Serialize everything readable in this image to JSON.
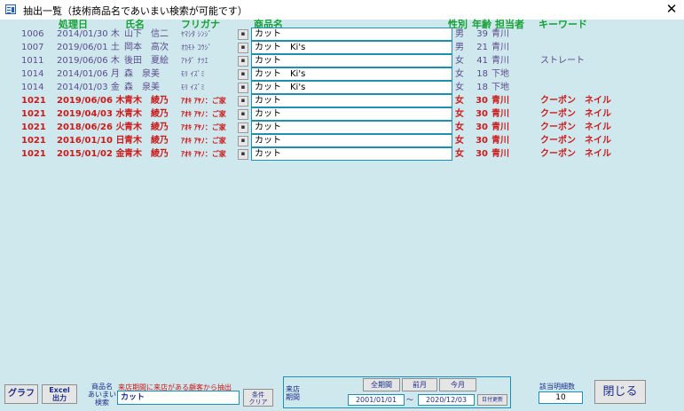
{
  "window": {
    "title": "抽出一覧（技術商品名であいまい検索が可能です）",
    "close_glyph": "✕",
    "icon": "form-icon"
  },
  "headers": {
    "date": "処理日",
    "name": "氏名",
    "kana": "フリガナ",
    "product": "商品名",
    "gender": "性別",
    "age": "年齢",
    "staff": "担当者",
    "keyword": "キーワード"
  },
  "row_button_glyph": "▪",
  "rows": [
    {
      "id": "1006",
      "date": "2014/01/30 木",
      "name": "山下　信二",
      "kana": "ﾔﾏｼﾀ ｼﾝｼﾞ",
      "product": "カット",
      "gender": "男",
      "age": "39",
      "staff": "青川",
      "keyword": "",
      "highlight": false
    },
    {
      "id": "1007",
      "date": "2019/06/01 土",
      "name": "岡本　高次",
      "kana": "ｵｶﾓﾄ ｺｳｼﾞ",
      "product": "カット　Ki's",
      "gender": "男",
      "age": "21",
      "staff": "青川",
      "keyword": "",
      "highlight": false
    },
    {
      "id": "1011",
      "date": "2019/06/06 木",
      "name": "後田　夏絵",
      "kana": "ｱﾄﾀﾞ ﾅﾂｴ",
      "product": "カット",
      "gender": "女",
      "age": "41",
      "staff": "青川",
      "keyword": "ストレート",
      "highlight": false
    },
    {
      "id": "1014",
      "date": "2014/01/06 月",
      "name": "森　泉美",
      "kana": "ﾓﾘ ｲｽﾞﾐ",
      "product": "カット　Ki's",
      "gender": "女",
      "age": "18",
      "staff": "下地",
      "keyword": "",
      "highlight": false
    },
    {
      "id": "1014",
      "date": "2014/01/03 金",
      "name": "森　泉美",
      "kana": "ﾓﾘ ｲｽﾞﾐ",
      "product": "カット　Ki's",
      "gender": "女",
      "age": "18",
      "staff": "下地",
      "keyword": "",
      "highlight": false
    },
    {
      "id": "1021",
      "date": "2019/06/06 木",
      "name": "青木　綾乃",
      "kana": "ｱｵｷ ｱﾔﾉ：ご家",
      "product": "カット",
      "gender": "女",
      "age": "30",
      "staff": "青川",
      "keyword": "クーポン　ネイル",
      "highlight": true
    },
    {
      "id": "1021",
      "date": "2019/04/03 水",
      "name": "青木　綾乃",
      "kana": "ｱｵｷ ｱﾔﾉ：ご家",
      "product": "カット",
      "gender": "女",
      "age": "30",
      "staff": "青川",
      "keyword": "クーポン　ネイル",
      "highlight": true
    },
    {
      "id": "1021",
      "date": "2018/06/26 火",
      "name": "青木　綾乃",
      "kana": "ｱｵｷ ｱﾔﾉ：ご家",
      "product": "カット",
      "gender": "女",
      "age": "30",
      "staff": "青川",
      "keyword": "クーポン　ネイル",
      "highlight": true
    },
    {
      "id": "1021",
      "date": "2016/01/10 日",
      "name": "青木　綾乃",
      "kana": "ｱｵｷ ｱﾔﾉ：ご家",
      "product": "カット",
      "gender": "女",
      "age": "30",
      "staff": "青川",
      "keyword": "クーポン　ネイル",
      "highlight": true
    },
    {
      "id": "1021",
      "date": "2015/01/02 金",
      "name": "青木　綾乃",
      "kana": "ｱｵｷ ｱﾔﾉ：ご家",
      "product": "カット",
      "gender": "女",
      "age": "30",
      "staff": "青川",
      "keyword": "クーポン　ネイル",
      "highlight": true
    }
  ],
  "footer": {
    "graph_label": "グラフ",
    "excel_line1": "Excel",
    "excel_line2": "出力",
    "search_label_1": "商品名",
    "search_label_2": "あいまい",
    "search_label_3": "検索",
    "search_caption": "来店期間に来店がある顧客から抽出",
    "search_value": "カット",
    "clear_line1": "条件",
    "clear_line2": "クリア",
    "period_label_1": "来店",
    "period_label_2": "期間",
    "all_period": "全期間",
    "prev_month": "前月",
    "this_month": "今月",
    "date_from": "2001/01/01",
    "tilde": "～",
    "date_to": "2020/12/03",
    "date_update": "日付更新",
    "count_label": "該当明細数",
    "count_value": "10",
    "close_label": "閉じる"
  },
  "colors": {
    "background": "#cfe8ee",
    "normal_text": "#5b4c8c",
    "highlight_text": "#cc1a1a",
    "header_text": "#16a035",
    "button_text": "#1c2f8a",
    "field_border": "#1d8fb5"
  }
}
